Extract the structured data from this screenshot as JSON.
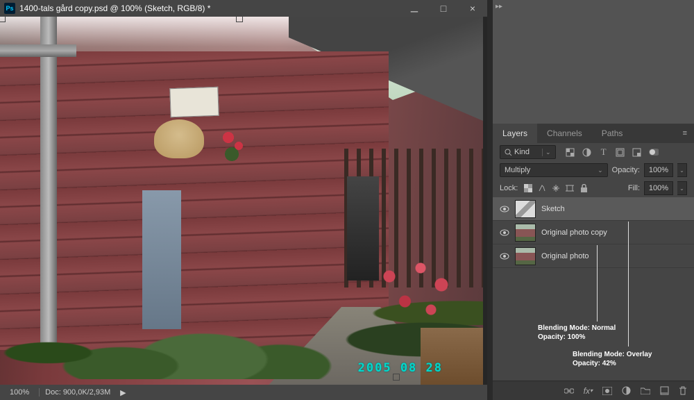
{
  "title": "1400-tals gård copy.psd @ 100% (Sketch, RGB/8) *",
  "zoom": "100%",
  "doc_info": "Doc: 900,0K/2,93M",
  "datestamp": "2005 08 28",
  "tabs": {
    "layers": "Layers",
    "channels": "Channels",
    "paths": "Paths"
  },
  "filter_label": "Kind",
  "blend_mode": "Multiply",
  "opacity_label": "Opacity:",
  "opacity_value": "100%",
  "lock_label": "Lock:",
  "fill_label": "Fill:",
  "fill_value": "100%",
  "layers": [
    {
      "name": "Sketch"
    },
    {
      "name": "Original photo copy"
    },
    {
      "name": "Original photo"
    }
  ],
  "annot1_line1": "Blending Mode: Normal",
  "annot1_line2": "Opacity: 100%",
  "annot2_line1": "Blending Mode: Overlay",
  "annot2_line2": "Opacity: 42%"
}
